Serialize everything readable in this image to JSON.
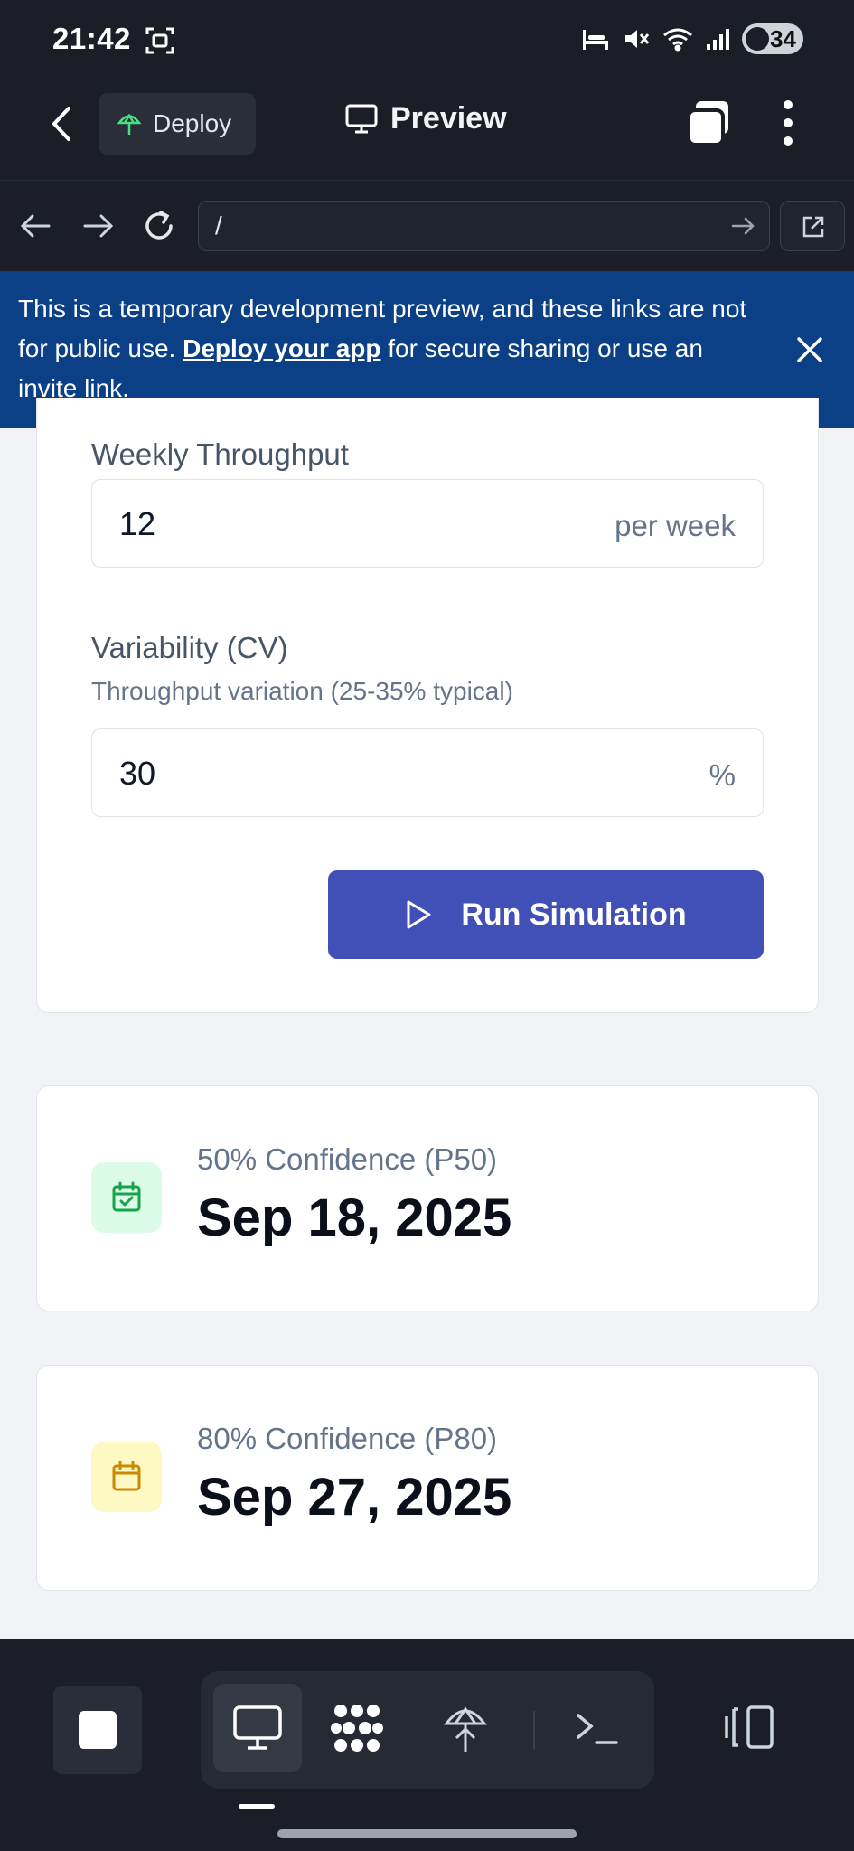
{
  "status_bar": {
    "time": "21:42",
    "battery": "34",
    "icons": [
      "screenshot-icon",
      "bed-icon",
      "mute-icon",
      "wifi-icon",
      "signal-icon",
      "battery-icon"
    ]
  },
  "app_bar": {
    "deploy_label": "Deploy",
    "preview_label": "Preview"
  },
  "url_bar": {
    "url": "/"
  },
  "banner": {
    "text_before": "This is a temporary development preview, and these links are not for public use. ",
    "link_text": "Deploy your app",
    "text_after": " for secure sharing or use an invite link."
  },
  "form": {
    "throughput": {
      "label": "Weekly Throughput",
      "value": "12",
      "unit": "per week"
    },
    "variability": {
      "label": "Variability (CV)",
      "help": "Throughput variation (25-35% typical)",
      "value": "30",
      "unit": "%"
    },
    "run_label": "Run Simulation"
  },
  "results": [
    {
      "label": "50% Confidence (P50)",
      "date": "Sep 18, 2025",
      "icon": "calendar-check-icon",
      "icon_color": "#16a34a",
      "icon_bg": "#dcfce7"
    },
    {
      "label": "80% Confidence (P80)",
      "date": "Sep 27, 2025",
      "icon": "calendar-icon",
      "icon_color": "#ca8a04",
      "icon_bg": "#fef9c3"
    }
  ],
  "colors": {
    "chrome": "#1b1e27",
    "banner": "#0b3f86",
    "primary_button": "#4150b6"
  }
}
